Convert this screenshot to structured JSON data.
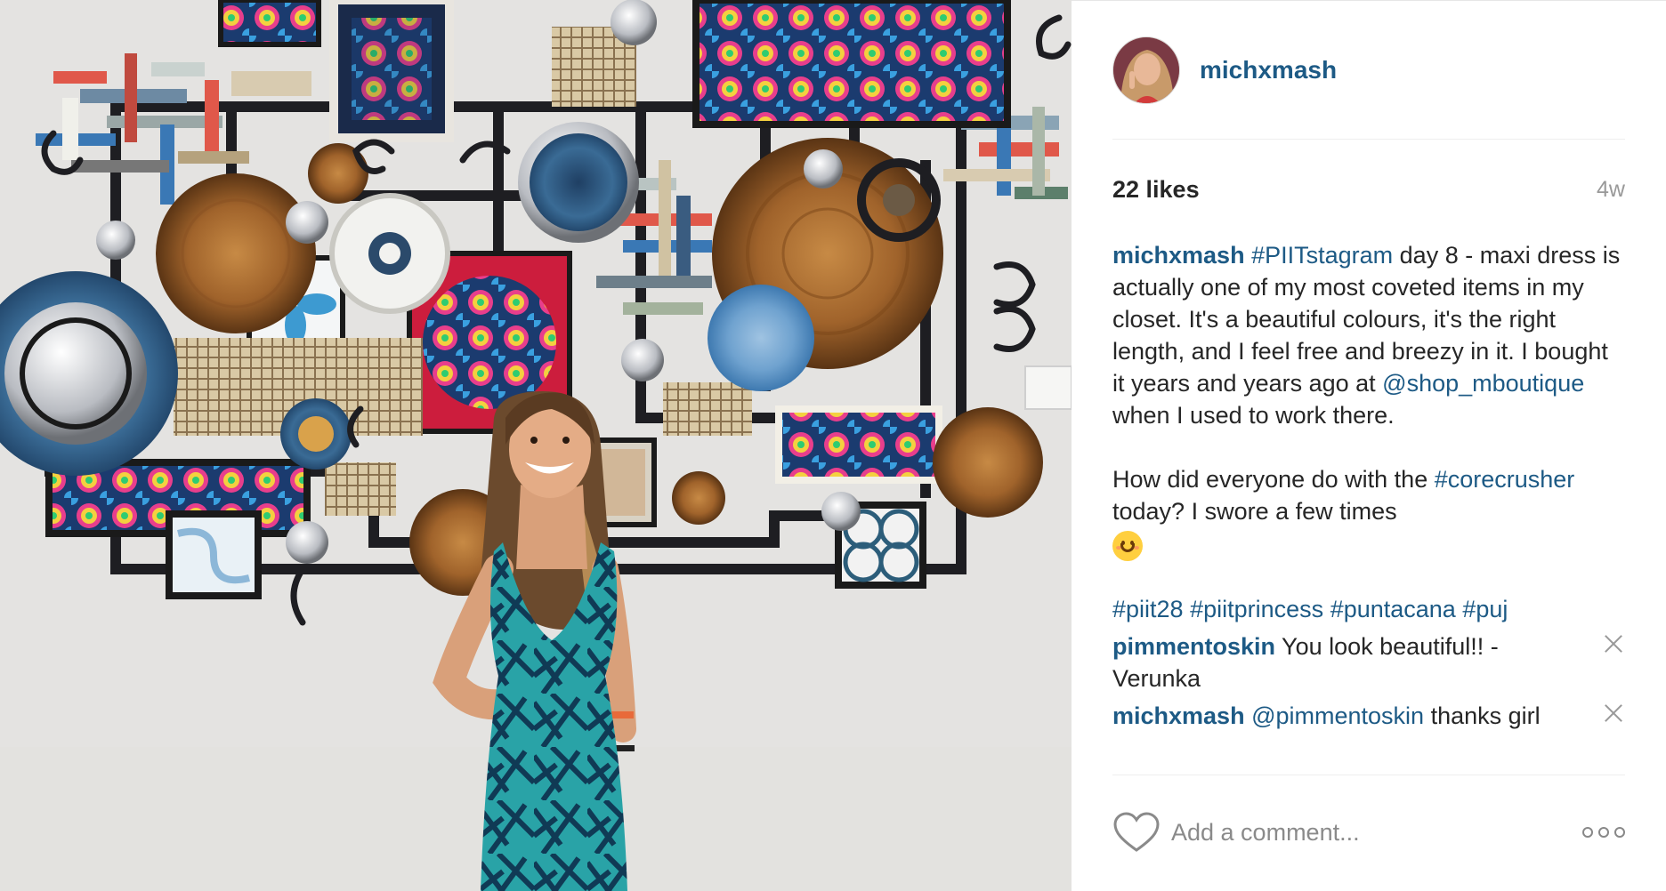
{
  "post": {
    "username": "michxmash",
    "likes_text": "22 likes",
    "age": "4w"
  },
  "comments": [
    {
      "author": "michxmash",
      "parts": [
        {
          "type": "link",
          "text": "#PIITstagram"
        },
        {
          "type": "text",
          "text": " day 8 - maxi dress is actually one of my most coveted items in my closet. It's a beautiful colours, it's the right length, and I feel free and breezy in it. I bought it years and years ago at "
        },
        {
          "type": "link",
          "text": "@shop_mboutique"
        },
        {
          "type": "text",
          "text": " when I used to work there."
        }
      ],
      "paragraph2_a": "How did everyone do with the ",
      "paragraph2_link": "#corecrusher",
      "paragraph2_b": " today? I swore a few times",
      "emoji": "smiling-face-emoji",
      "hashtags": [
        "#piit28",
        "#piitprincess",
        "#puntacana",
        "#puj"
      ]
    }
  ],
  "replies": [
    {
      "author": "pimmentoskin",
      "text": "You look beautiful!! - Verunka"
    },
    {
      "author": "michxmash",
      "link": "@pimmentoskin",
      "text": " thanks girl"
    }
  ],
  "footer": {
    "add_comment_placeholder": "Add a comment...",
    "like_icon": "heart-outline-icon",
    "more_icon": "more-options-icon"
  },
  "colors": {
    "link": "#1d5a85",
    "muted": "#999999",
    "wall": "#e9e8e6"
  }
}
